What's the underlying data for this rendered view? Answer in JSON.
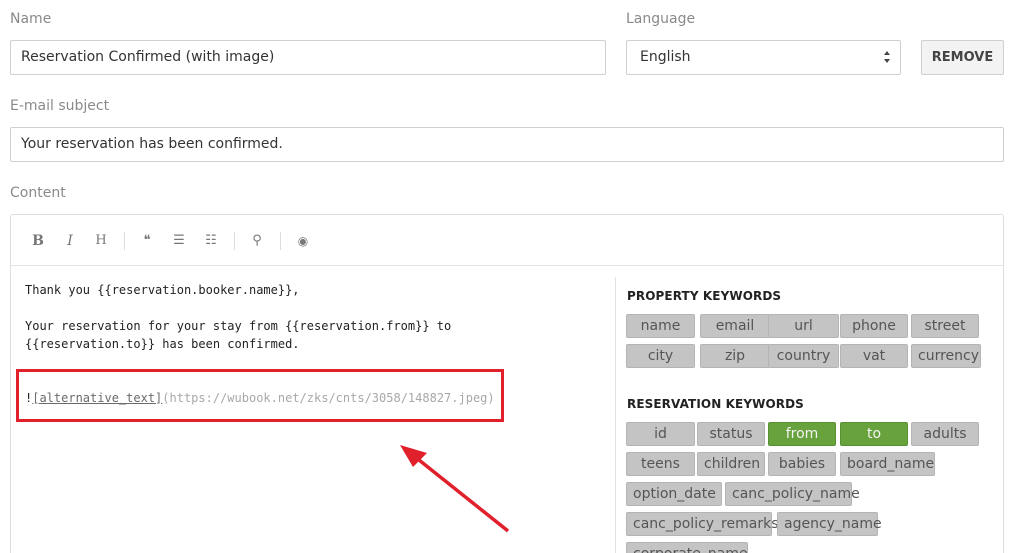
{
  "form": {
    "name_label": "Name",
    "name_value": "Reservation Confirmed (with image)",
    "language_label": "Language",
    "language_value": "English",
    "remove_label": "REMOVE",
    "subject_label": "E-mail subject",
    "subject_value": "Your reservation has been confirmed.",
    "content_label": "Content"
  },
  "toolbar": {
    "bold": "B",
    "italic": "I",
    "heading": "H",
    "quote": "❝",
    "ul": "☰",
    "ol": "☷",
    "link": "⚲",
    "preview": "◉"
  },
  "content": {
    "line1": "Thank you {{reservation.booker.name}},",
    "line2": "Your reservation for your stay from {{reservation.from}} to",
    "line3": "{{reservation.to}} has been confirmed.",
    "img_bang": "!",
    "img_alt": "[alternative_text]",
    "img_url": "(https://wubook.net/zks/cnts/3058/148827.jpeg)"
  },
  "keywords": {
    "property_title": "PROPERTY KEYWORDS",
    "property": [
      "name",
      "email",
      "url",
      "phone",
      "street",
      "city",
      "zip",
      "country",
      "vat",
      "currency"
    ],
    "reservation_title": "RESERVATION KEYWORDS",
    "reservation": [
      "id",
      "status",
      "from",
      "to",
      "adults",
      "teens",
      "children",
      "babies",
      "board_name",
      "option_date",
      "canc_policy_name",
      "canc_policy_remarks",
      "agency_name",
      "corporate_name"
    ],
    "highlighted": [
      "from",
      "to"
    ],
    "highlight_color": "#67a23d"
  },
  "annotation": {
    "color": "#e0202a"
  }
}
